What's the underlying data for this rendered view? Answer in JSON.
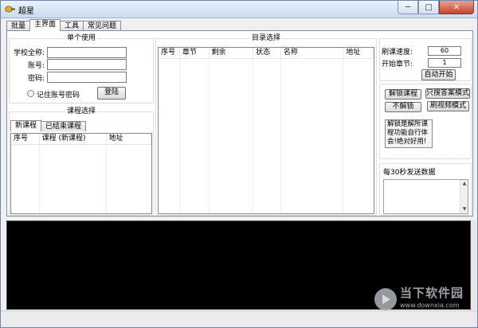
{
  "window": {
    "title": "超星",
    "minimize": "─",
    "maximize": "□",
    "close": "✕"
  },
  "tabs": [
    "批量",
    "主界面",
    "工具",
    "常见问题"
  ],
  "login": {
    "title": "单个使用",
    "school_label": "学校全称:",
    "account_label": "账号:",
    "password_label": "密码:",
    "remember_label": "记住账号密码",
    "login_button": "登陆"
  },
  "course": {
    "title": "课程选择",
    "subtabs": [
      "新课程",
      "已结束课程"
    ],
    "columns": [
      "序号",
      "课程 (新课程)",
      "地址"
    ]
  },
  "catalog": {
    "title": "目录选择",
    "columns": [
      "序号",
      "章节",
      "剩余",
      "状态",
      "名称",
      "地址"
    ]
  },
  "settings": {
    "speed_label": "刷课速度:",
    "speed_value": "60",
    "start_chapter_label": "开始章节:",
    "start_chapter_value": "1",
    "auto_start": "自动开始"
  },
  "actions": {
    "unlock": "解锁课程",
    "answer_mode": "只搜答案模式",
    "no_unlock": "不解锁",
    "video_mode": "刷视频模式"
  },
  "info_text": "解锁是解所课程功能自行体会!绝对好用!",
  "send_data_title": "每30秒发送数据",
  "watermark": {
    "name": "当下软件园",
    "url": "www.downxia.com"
  }
}
